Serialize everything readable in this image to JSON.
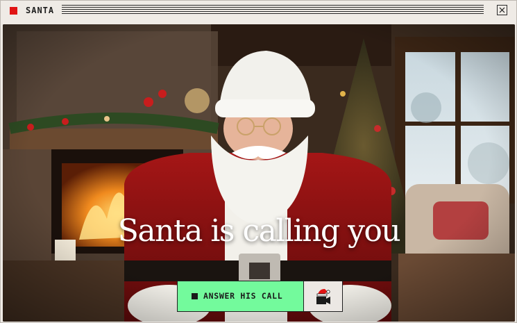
{
  "window": {
    "title": "SANTA"
  },
  "icons": {
    "app": "app-red-square-icon",
    "close": "close-icon",
    "answer": "stop-square-icon",
    "video": "santa-hat-video-camera-icon"
  },
  "hero": {
    "headline": "Santa is calling you"
  },
  "actions": {
    "answer_label": "ANSWER HIS CALL"
  },
  "colors": {
    "accent_red": "#e11414",
    "answer_green": "#73fa9c",
    "window_bg": "#efebe6"
  }
}
